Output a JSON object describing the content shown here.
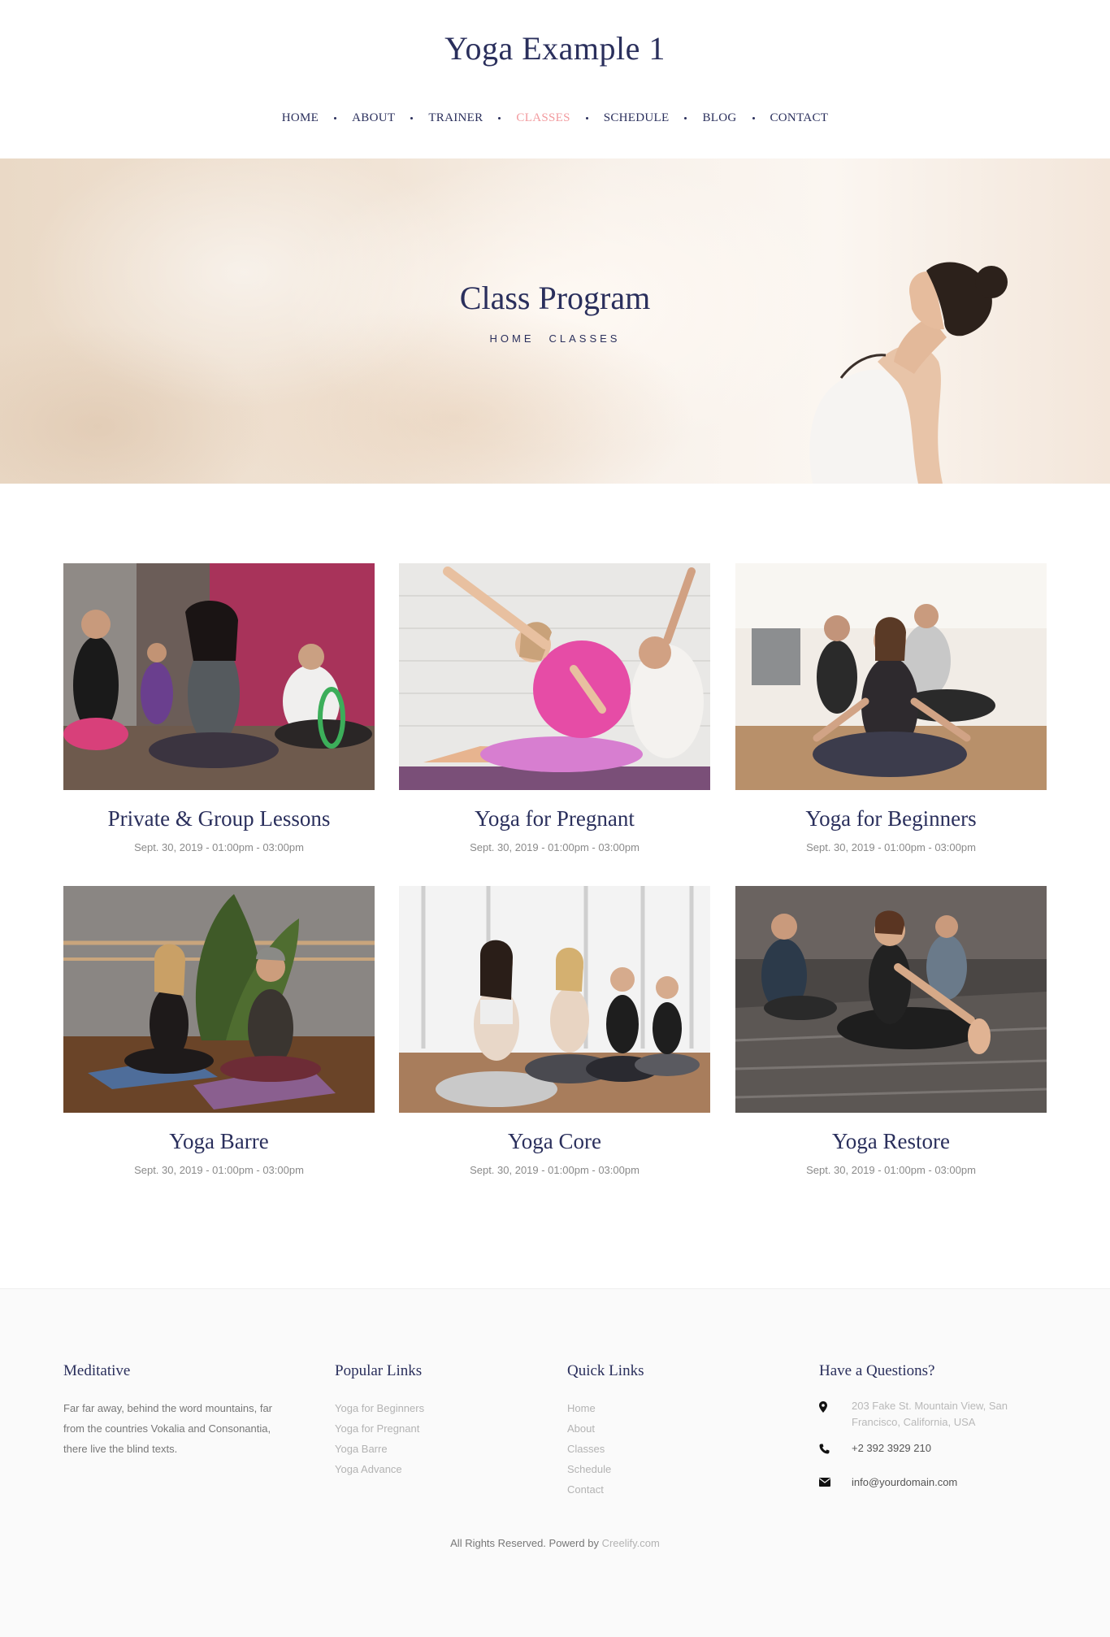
{
  "header": {
    "site_title": "Yoga Example 1",
    "nav": [
      {
        "label": "HOME",
        "active": false
      },
      {
        "label": "ABOUT",
        "active": false
      },
      {
        "label": "TRAINER",
        "active": false
      },
      {
        "label": "CLASSES",
        "active": true
      },
      {
        "label": "SCHEDULE",
        "active": false
      },
      {
        "label": "BLOG",
        "active": false
      },
      {
        "label": "CONTACT",
        "active": false
      }
    ]
  },
  "hero": {
    "title": "Class Program",
    "breadcrumb": [
      "HOME",
      "CLASSES"
    ]
  },
  "classes": [
    {
      "title": "Private & Group Lessons",
      "date": "Sept. 30, 2019 - 01:00pm - 03:00pm",
      "image": "group-class-photo"
    },
    {
      "title": "Yoga for Pregnant",
      "date": "Sept. 30, 2019 - 01:00pm - 03:00pm",
      "image": "pregnant-stretch-photo"
    },
    {
      "title": "Yoga for Beginners",
      "date": "Sept. 30, 2019 - 01:00pm - 03:00pm",
      "image": "beginners-meditation-photo"
    },
    {
      "title": "Yoga Barre",
      "date": "Sept. 30, 2019 - 01:00pm - 03:00pm",
      "image": "barre-couple-photo"
    },
    {
      "title": "Yoga Core",
      "date": "Sept. 30, 2019 - 01:00pm - 03:00pm",
      "image": "core-row-photo"
    },
    {
      "title": "Yoga Restore",
      "date": "Sept. 30, 2019 - 01:00pm - 03:00pm",
      "image": "restore-stretch-photo"
    }
  ],
  "footer": {
    "about": {
      "heading": "Meditative",
      "text": "Far far away, behind the word mountains, far from the countries Vokalia and Consonantia, there live the blind texts."
    },
    "popular": {
      "heading": "Popular Links",
      "links": [
        "Yoga for Beginners",
        "Yoga for Pregnant",
        "Yoga Barre",
        "Yoga Advance"
      ]
    },
    "quick": {
      "heading": "Quick Links",
      "links": [
        "Home",
        "About",
        "Classes",
        "Schedule",
        "Contact"
      ]
    },
    "contact": {
      "heading": "Have a Questions?",
      "address": "203 Fake St. Mountain View, San Francisco, California, USA",
      "phone": "+2 392 3929 210",
      "email": "info@yourdomain.com"
    },
    "copyright_text": "All Rights Reserved. Powerd by",
    "copyright_link": "Creelify.com"
  },
  "icons": {
    "address": "map-marker-icon",
    "phone": "phone-icon",
    "email": "envelope-icon"
  },
  "colors": {
    "primary": "#2a2f5c",
    "accent": "#f29a9e",
    "muted": "#b3b3b3"
  }
}
